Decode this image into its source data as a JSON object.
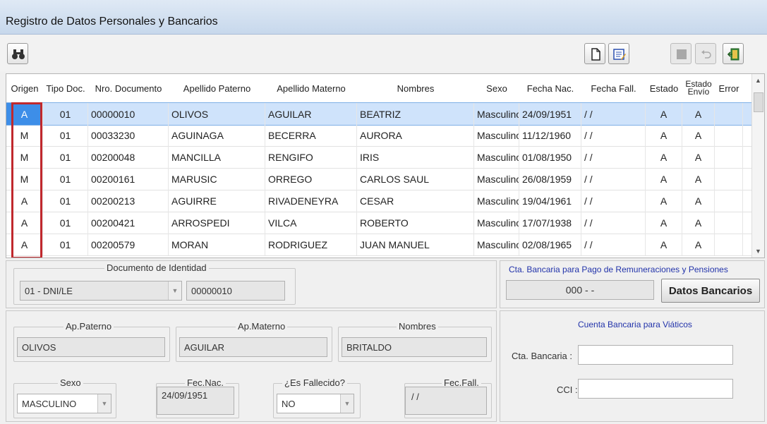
{
  "window": {
    "title": "Registro de Datos Personales y Bancarios"
  },
  "toolbar": {
    "search_icon": "binoculars-icon",
    "new_icon": "new-document-icon",
    "edit_icon": "edit-form-icon",
    "stop_icon": "stop-icon",
    "undo_icon": "undo-icon",
    "exit_icon": "exit-door-icon"
  },
  "grid": {
    "headers": {
      "origen": "Origen",
      "tipo_doc": "Tipo Doc.",
      "nro_documento": "Nro. Documento",
      "apellido_paterno": "Apellido Paterno",
      "apellido_materno": "Apellido Materno",
      "nombres": "Nombres",
      "sexo": "Sexo",
      "fecha_nac": "Fecha Nac.",
      "fecha_fall": "Fecha Fall.",
      "estado": "Estado",
      "estado_envio_1": "Estado",
      "estado_envio_2": "Envío",
      "error": "Error"
    },
    "rows": [
      {
        "origen": "A",
        "tipo": "01",
        "nro": "00000010",
        "paterno": "OLIVOS",
        "materno": "AGUILAR",
        "nombres": "BEATRIZ",
        "sexo": "Masculino",
        "nac": "24/09/1951",
        "fall": "/ /",
        "estado": "A",
        "envio": "A",
        "error": ""
      },
      {
        "origen": "M",
        "tipo": "01",
        "nro": "00033230",
        "paterno": "AGUINAGA",
        "materno": "BECERRA",
        "nombres": "AURORA",
        "sexo": "Masculino",
        "nac": "11/12/1960",
        "fall": "/ /",
        "estado": "A",
        "envio": "A",
        "error": ""
      },
      {
        "origen": "M",
        "tipo": "01",
        "nro": "00200048",
        "paterno": "MANCILLA",
        "materno": "RENGIFO",
        "nombres": "IRIS",
        "sexo": "Masculino",
        "nac": "01/08/1950",
        "fall": "/ /",
        "estado": "A",
        "envio": "A",
        "error": ""
      },
      {
        "origen": "M",
        "tipo": "01",
        "nro": "00200161",
        "paterno": "MARUSIC",
        "materno": "ORREGO",
        "nombres": "CARLOS SAUL",
        "sexo": "Masculino",
        "nac": "26/08/1959",
        "fall": "/ /",
        "estado": "A",
        "envio": "A",
        "error": ""
      },
      {
        "origen": "A",
        "tipo": "01",
        "nro": "00200213",
        "paterno": "AGUIRRE",
        "materno": "RIVADENEYRA",
        "nombres": "CESAR",
        "sexo": "Masculino",
        "nac": "19/04/1961",
        "fall": "/ /",
        "estado": "A",
        "envio": "A",
        "error": ""
      },
      {
        "origen": "A",
        "tipo": "01",
        "nro": "00200421",
        "paterno": "ARROSPEDI",
        "materno": "VILCA",
        "nombres": "ROBERTO",
        "sexo": "Masculino",
        "nac": "17/07/1938",
        "fall": "/ /",
        "estado": "A",
        "envio": "A",
        "error": ""
      },
      {
        "origen": "A",
        "tipo": "01",
        "nro": "00200579",
        "paterno": "MORAN",
        "materno": "RODRIGUEZ",
        "nombres": "JUAN MANUEL",
        "sexo": "Masculino",
        "nac": "02/08/1965",
        "fall": "/ /",
        "estado": "A",
        "envio": "A",
        "error": ""
      }
    ],
    "selected_row": 0
  },
  "documento": {
    "legend": "Documento de Identidad",
    "tipo_value": "01 - DNI/LE",
    "numero_value": "00000010"
  },
  "cta_remuneraciones": {
    "title": "Cta. Bancaria para Pago de Remuneraciones y Pensiones",
    "value": "000 - -",
    "button": "Datos Bancarios"
  },
  "personal": {
    "ap_paterno_legend": "Ap.Paterno",
    "ap_paterno_value": "OLIVOS",
    "ap_materno_legend": "Ap.Materno",
    "ap_materno_value": "AGUILAR",
    "nombres_legend": "Nombres",
    "nombres_value": "BRITALDO",
    "sexo_legend": "Sexo",
    "sexo_value": "MASCULINO",
    "fec_nac_legend": "Fec.Nac.",
    "fec_nac_value": "24/09/1951",
    "fallecido_legend": "¿Es Fallecido?",
    "fallecido_value": "NO",
    "fec_fall_legend": "Fec.Fall.",
    "fec_fall_value": "/ /"
  },
  "viaticos": {
    "title": "Cuenta Bancaria para Viáticos",
    "cta_label": "Cta. Bancaria :",
    "cta_value": "",
    "cci_label": "CCI :",
    "cci_value": ""
  },
  "colors": {
    "selection": "#cfe3fb",
    "highlight_box": "#c0282d",
    "section_title": "#2233aa"
  }
}
